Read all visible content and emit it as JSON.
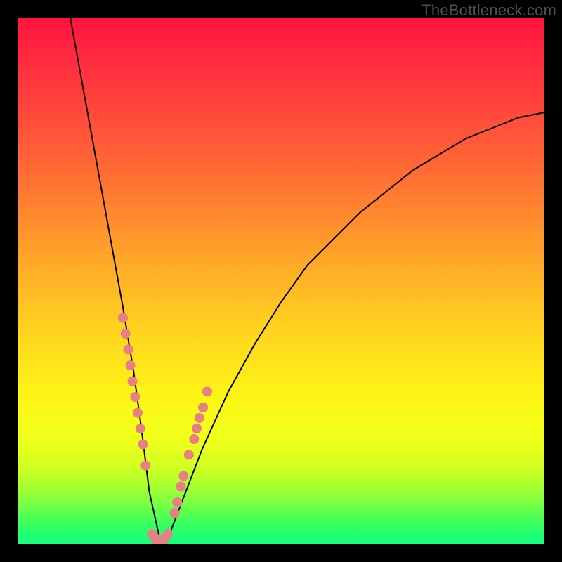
{
  "watermark": "TheBottleneck.com",
  "colors": {
    "frame": "#000000",
    "gradient_top": "#ff123f",
    "gradient_bottom": "#16ff7e",
    "curve": "#000000",
    "markers": "#e77f84"
  },
  "chart_data": {
    "type": "line",
    "title": "",
    "xlabel": "",
    "ylabel": "",
    "xlim": [
      0,
      100
    ],
    "ylim": [
      0,
      100
    ],
    "grid": false,
    "legend": false,
    "notes": "V-shaped bottleneck curve over a red→green vertical gradient. Axes carry no tick labels; curve values estimated from pixel position. A small cluster of salmon-colored markers sits on both curve legs at roughly y=20–35 and at the valley floor (y≈1).",
    "series": [
      {
        "name": "bottleneck-curve",
        "x": [
          10,
          12,
          14,
          16,
          18,
          20,
          22,
          23.5,
          25,
          27,
          28.5,
          30,
          35,
          40,
          45,
          50,
          55,
          60,
          65,
          70,
          75,
          80,
          85,
          90,
          95,
          100
        ],
        "y": [
          100,
          89,
          78,
          67,
          56,
          45,
          33,
          22,
          10,
          1,
          1,
          5,
          18,
          29,
          38,
          46,
          53,
          58,
          63,
          67,
          71,
          74,
          77,
          79,
          81,
          82
        ]
      }
    ],
    "markers": [
      {
        "x": 20.0,
        "y": 43
      },
      {
        "x": 20.5,
        "y": 40
      },
      {
        "x": 21.0,
        "y": 37
      },
      {
        "x": 21.4,
        "y": 34
      },
      {
        "x": 21.8,
        "y": 31
      },
      {
        "x": 22.3,
        "y": 28
      },
      {
        "x": 22.8,
        "y": 25
      },
      {
        "x": 23.3,
        "y": 22
      },
      {
        "x": 23.8,
        "y": 19
      },
      {
        "x": 24.3,
        "y": 15
      },
      {
        "x": 25.5,
        "y": 2
      },
      {
        "x": 26.2,
        "y": 1
      },
      {
        "x": 27.0,
        "y": 1
      },
      {
        "x": 27.8,
        "y": 1
      },
      {
        "x": 28.5,
        "y": 2
      },
      {
        "x": 29.8,
        "y": 6
      },
      {
        "x": 30.3,
        "y": 8
      },
      {
        "x": 31.0,
        "y": 11
      },
      {
        "x": 31.5,
        "y": 13
      },
      {
        "x": 32.5,
        "y": 17
      },
      {
        "x": 33.5,
        "y": 20
      },
      {
        "x": 34.0,
        "y": 22
      },
      {
        "x": 34.5,
        "y": 24
      },
      {
        "x": 35.2,
        "y": 26
      },
      {
        "x": 36.0,
        "y": 29
      }
    ]
  }
}
